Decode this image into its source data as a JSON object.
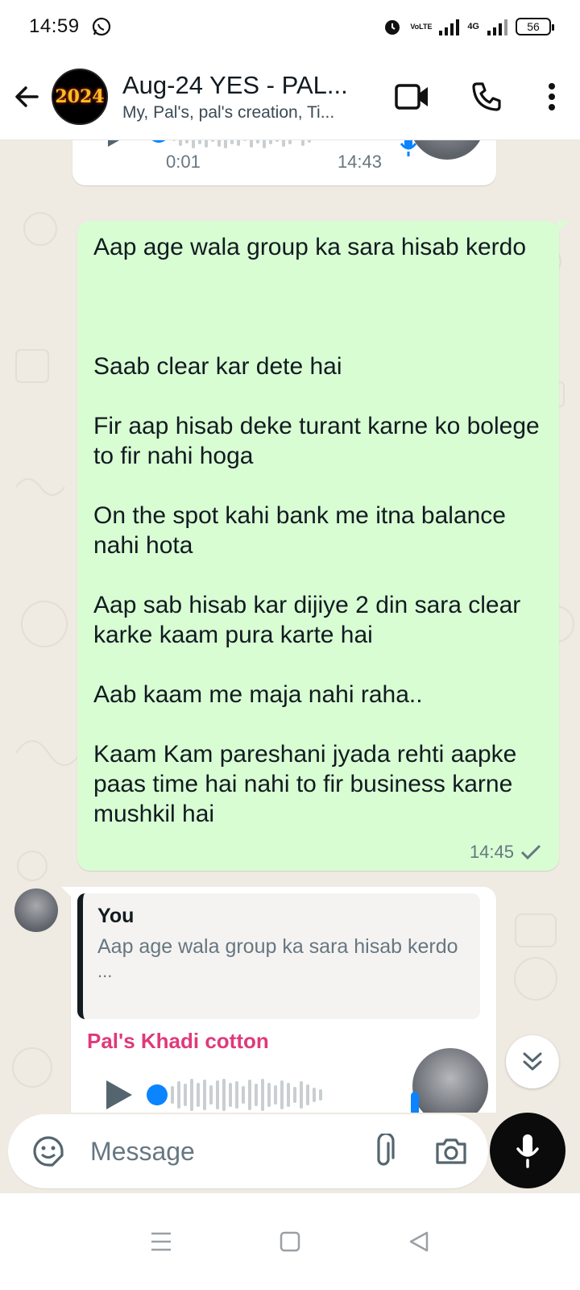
{
  "status_bar": {
    "time": "14:59",
    "volte": "VoLTE",
    "network": "4G",
    "battery": "56"
  },
  "header": {
    "title": "Aug-24 YES - PAL...",
    "subtitle": "My, Pal's, pal's creation, Ti...",
    "avatar_text": "2024"
  },
  "messages": {
    "voice_top": {
      "duration": "0:01",
      "time": "14:43"
    },
    "outgoing": {
      "text": "Aap age wala group ka sara hisab kerdo\n\n\n\nSaab clear kar dete hai\n\nFir aap hisab deke turant karne ko bolege to fir nahi hoga\n\nOn the spot kahi bank me itna balance nahi hota\n\nAap sab hisab kar dijiye 2 din sara clear karke kaam pura karte hai\n\nAab kaam me maja nahi raha..\n\nKaam Kam pareshani jyada rehti aapke paas time hai nahi to fir business karne mushkil hai",
      "time": "14:45",
      "status": "sent"
    },
    "incoming_reply": {
      "quote_author": "You",
      "quote_text": "Aap age wala group ka sara hisab kerdo",
      "quote_more": "...",
      "sender": "Pal's Khadi cotton"
    }
  },
  "composer": {
    "placeholder": "Message"
  },
  "colors": {
    "bubble_out": "#d9fdd3",
    "bubble_in": "#ffffff",
    "background": "#efeae2",
    "sender_name": "#e0397a",
    "voice_accent": "#0a84ff"
  },
  "icons": {
    "back": "arrow-left-icon",
    "video": "video-call-icon",
    "call": "phone-icon",
    "menu": "more-vertical-icon",
    "emoji": "sticker-icon",
    "attach": "paperclip-icon",
    "camera": "camera-icon",
    "mic": "mic-icon",
    "scroll": "chevron-double-down-icon"
  }
}
